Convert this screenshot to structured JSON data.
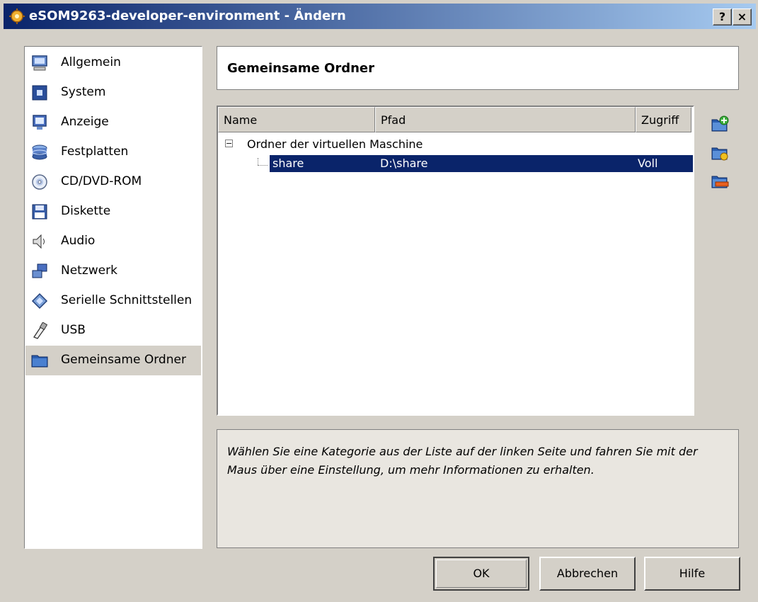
{
  "window": {
    "title": "eSOM9263-developer-environment - Ändern",
    "help_btn": "?",
    "close_btn": "×"
  },
  "sidebar": {
    "items": [
      {
        "label": "Allgemein",
        "icon": "monitor-icon"
      },
      {
        "label": "System",
        "icon": "chip-icon"
      },
      {
        "label": "Anzeige",
        "icon": "display-icon"
      },
      {
        "label": "Festplatten",
        "icon": "harddisk-icon"
      },
      {
        "label": "CD/DVD-ROM",
        "icon": "cd-icon"
      },
      {
        "label": "Diskette",
        "icon": "floppy-icon"
      },
      {
        "label": "Audio",
        "icon": "speaker-icon"
      },
      {
        "label": "Netzwerk",
        "icon": "network-icon"
      },
      {
        "label": "Serielle Schnittstellen",
        "icon": "serial-icon"
      },
      {
        "label": "USB",
        "icon": "usb-icon"
      },
      {
        "label": "Gemeinsame Ordner",
        "icon": "folder-icon",
        "selected": true
      }
    ]
  },
  "main": {
    "title": "Gemeinsame Ordner",
    "columns": [
      "Name",
      "Pfad",
      "Zugriff"
    ],
    "group": "Ordner der virtuellen Maschine",
    "rows": [
      {
        "name": "share",
        "path": "D:\\share",
        "access": "Voll"
      }
    ],
    "info": "Wählen Sie eine Kategorie aus der Liste auf der linken Seite und fahren Sie mit der Maus über eine Einstellung, um mehr Informationen zu erhalten."
  },
  "buttons": {
    "ok": "OK",
    "cancel": "Abbrechen",
    "help": "Hilfe"
  },
  "colors": {
    "selection": "#0a246a",
    "face": "#d4d0c8",
    "info_bg": "#e9e6e0"
  }
}
